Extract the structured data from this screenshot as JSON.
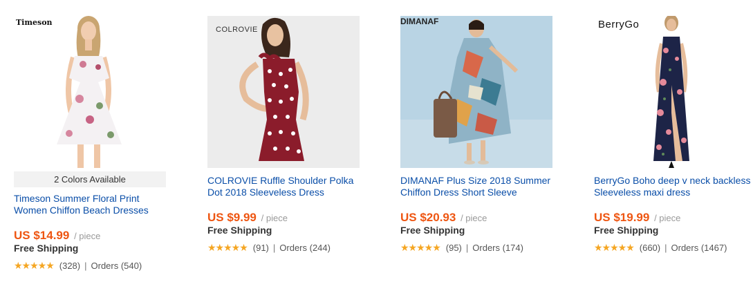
{
  "products": [
    {
      "brand": "Timeson",
      "colors_available": "2 Colors Available",
      "title": "Timeson Summer Floral Print Women Chiffon Beach Dresses",
      "price": "US $14.99",
      "unit": "/ piece",
      "shipping": "Free Shipping",
      "reviews": "(328)",
      "orders": "Orders (540)",
      "rating": 5
    },
    {
      "brand": "COLROVIE",
      "title": "COLROVIE Ruffle Shoulder Polka Dot 2018 Sleeveless Dress",
      "price": "US $9.99",
      "unit": "/ piece",
      "shipping": "Free Shipping",
      "reviews": "(91)",
      "orders": "Orders (244)",
      "rating": 5
    },
    {
      "brand": "DIMANAF",
      "title": "DIMANAF Plus Size 2018 Summer Chiffon Dress Short Sleeve",
      "price": "US $20.93",
      "unit": "/ piece",
      "shipping": "Free Shipping",
      "reviews": "(95)",
      "orders": "Orders (174)",
      "rating": 5
    },
    {
      "brand": "BerryGo",
      "title": "BerryGo Boho deep v neck backless Sleeveless maxi dress",
      "price": "US $19.99",
      "unit": "/ piece",
      "shipping": "Free Shipping",
      "reviews": "(660)",
      "orders": "Orders (1467)",
      "rating": 5
    }
  ],
  "separator": "|",
  "stars": "★★★★★"
}
